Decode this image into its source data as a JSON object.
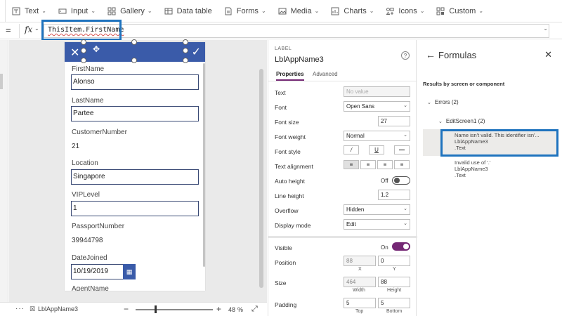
{
  "ribbon": {
    "items": [
      {
        "label": "Text",
        "icon": "text-icon"
      },
      {
        "label": "Input",
        "icon": "input-icon"
      },
      {
        "label": "Gallery",
        "icon": "gallery-icon"
      },
      {
        "label": "Data table",
        "icon": "data-table-icon"
      },
      {
        "label": "Forms",
        "icon": "forms-icon"
      },
      {
        "label": "Media",
        "icon": "media-icon"
      },
      {
        "label": "Charts",
        "icon": "charts-icon"
      },
      {
        "label": "Icons",
        "icon": "icons-icon"
      },
      {
        "label": "Custom",
        "icon": "custom-icon"
      }
    ]
  },
  "formula_bar": {
    "eq": "=",
    "fx": "fx",
    "formula": "ThisItem.FirstName"
  },
  "form": {
    "fields": [
      {
        "label": "FirstName",
        "value": "Alonso",
        "kind": "input"
      },
      {
        "label": "LastName",
        "value": "Partee",
        "kind": "input"
      },
      {
        "label": "CustomerNumber",
        "value": "21",
        "kind": "text"
      },
      {
        "label": "Location",
        "value": "Singapore",
        "kind": "input"
      },
      {
        "label": "VIPLevel",
        "value": "1",
        "kind": "input"
      },
      {
        "label": "PassportNumber",
        "value": "39944798",
        "kind": "text"
      },
      {
        "label": "DateJoined",
        "value": "10/19/2019",
        "kind": "date"
      },
      {
        "label": "AgentName",
        "value": "",
        "kind": "label"
      }
    ]
  },
  "bottom_bar": {
    "dots": "···",
    "screen_name": "LblAppName3",
    "zoom_value": "48",
    "zoom_unit": "%"
  },
  "properties": {
    "kind": "LABEL",
    "control_name": "LblAppName3",
    "tabs": [
      "Properties",
      "Advanced"
    ],
    "rows": {
      "text": {
        "label": "Text",
        "value": "No value"
      },
      "font": {
        "label": "Font",
        "value": "Open Sans"
      },
      "font_size": {
        "label": "Font size",
        "value": "27"
      },
      "font_weight": {
        "label": "Font weight",
        "value": "Normal"
      },
      "font_style": {
        "label": "Font style"
      },
      "text_alignment": {
        "label": "Text alignment"
      },
      "auto_height": {
        "label": "Auto height",
        "value": "Off"
      },
      "line_height": {
        "label": "Line height",
        "value": "1.2"
      },
      "overflow": {
        "label": "Overflow",
        "value": "Hidden"
      },
      "display_mode": {
        "label": "Display mode",
        "value": "Edit"
      },
      "visible": {
        "label": "Visible",
        "value": "On"
      },
      "position": {
        "label": "Position",
        "x": "88",
        "y": "0",
        "x_label": "X",
        "y_label": "Y"
      },
      "size": {
        "label": "Size",
        "width": "464",
        "height": "88",
        "width_label": "Width",
        "height_label": "Height"
      },
      "padding": {
        "label": "Padding",
        "top": "5",
        "bottom": "5",
        "top_label": "Top",
        "bottom_label": "Bottom"
      }
    }
  },
  "formulas": {
    "title": "Formulas",
    "results_heading": "Results by screen or component",
    "errors": "Errors (2)",
    "screen": "EditScreen1 (2)",
    "error1": [
      "Name isn't valid. This identifier isn'...",
      "LblAppName3",
      ".Text"
    ],
    "error2": [
      "Invalid use of '.'",
      "LblAppName3",
      ".Text"
    ]
  },
  "colors": {
    "accent_blue": "#3a5ba9",
    "highlight": "#1e73be",
    "toggle_purple": "#742774"
  }
}
